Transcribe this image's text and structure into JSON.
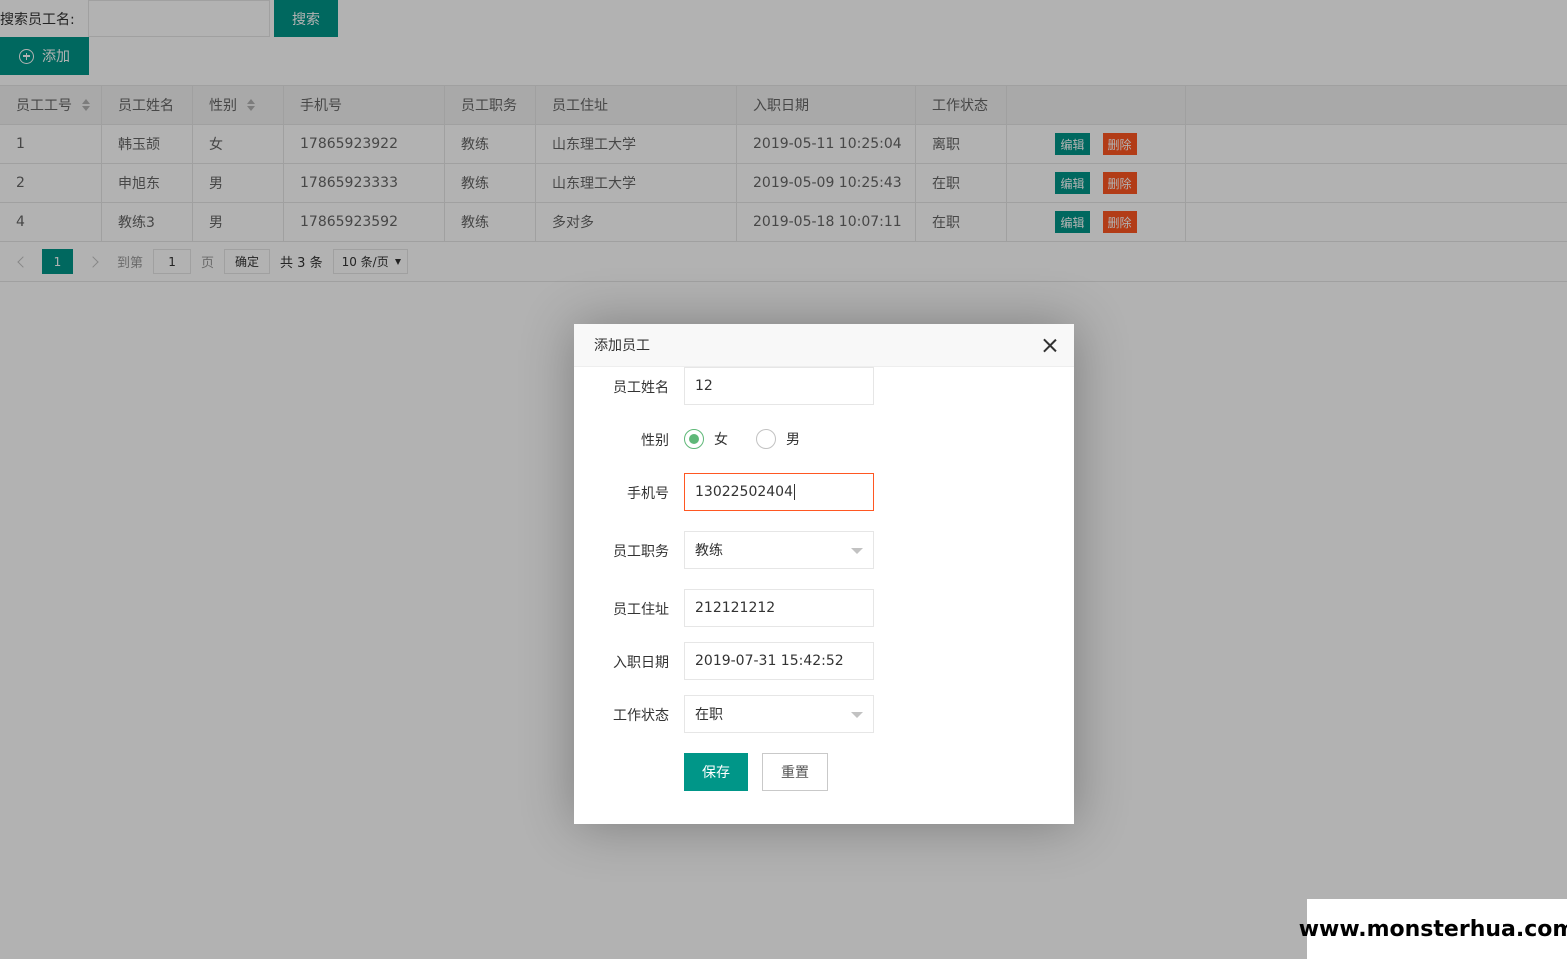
{
  "search": {
    "label": "搜索员工名:",
    "value": "",
    "button": "搜索"
  },
  "toolbar": {
    "add_label": "添加"
  },
  "table": {
    "columns": [
      "员工工号",
      "员工姓名",
      "性别",
      "手机号",
      "员工职务",
      "员工住址",
      "入职日期",
      "工作状态",
      ""
    ],
    "rows": [
      {
        "id": "1",
        "name": "韩玉颉",
        "gender": "女",
        "phone": "17865923922",
        "position": "教练",
        "address": "山东理工大学",
        "date": "2019-05-11 10:25:04",
        "status": "离职"
      },
      {
        "id": "2",
        "name": "申旭东",
        "gender": "男",
        "phone": "17865923333",
        "position": "教练",
        "address": "山东理工大学",
        "date": "2019-05-09 10:25:43",
        "status": "在职"
      },
      {
        "id": "4",
        "name": "教练3",
        "gender": "男",
        "phone": "17865923592",
        "position": "教练",
        "address": "多对多",
        "date": "2019-05-18 10:07:11",
        "status": "在职"
      }
    ],
    "edit_label": "编辑",
    "delete_label": "删除"
  },
  "pagination": {
    "current": "1",
    "goto_prefix": "到第",
    "goto_value": "1",
    "goto_suffix": "页",
    "confirm": "确定",
    "total": "共 3 条",
    "page_size": "10 条/页"
  },
  "modal": {
    "title": "添加员工",
    "fields": {
      "name": {
        "label": "员工姓名",
        "value": "12"
      },
      "gender": {
        "label": "性别",
        "options": [
          "女",
          "男"
        ],
        "selected": "女"
      },
      "phone": {
        "label": "手机号",
        "value": "13022502404"
      },
      "position": {
        "label": "员工职务",
        "value": "教练"
      },
      "address": {
        "label": "员工住址",
        "value": "212121212"
      },
      "date": {
        "label": "入职日期",
        "value": "2019-07-31 15:42:52"
      },
      "status": {
        "label": "工作状态",
        "value": "在职"
      }
    },
    "save_label": "保存",
    "reset_label": "重置"
  },
  "colors": {
    "primary": "#009688",
    "danger": "#FF5722",
    "radio": "#5FB878"
  },
  "watermark": "www.monsterhua.com"
}
